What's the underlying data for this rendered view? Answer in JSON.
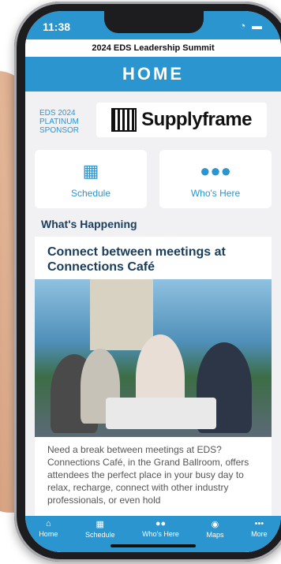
{
  "status": {
    "time": "11:38",
    "signal": "wifi battery"
  },
  "event": {
    "title": "2024 EDS Leadership Summit"
  },
  "header": {
    "title": "HOME"
  },
  "sponsor": {
    "label": "EDS 2024 PLATINUM SPONSOR",
    "logo_text": "Supplyframe"
  },
  "tiles": [
    {
      "label": "Schedule",
      "icon": "calendar-icon"
    },
    {
      "label": "Who's Here",
      "icon": "people-icon"
    }
  ],
  "section": {
    "title": "What's Happening"
  },
  "card": {
    "title": "Connect between meetings at Connections Café",
    "body": "Need a break between meetings at EDS? Connections Café, in the Grand Ballroom, offers attendees the perfect place in your busy day to relax, recharge, connect with other industry professionals, or even hold"
  },
  "tabbar": [
    {
      "label": "Home",
      "icon": "home-icon"
    },
    {
      "label": "Schedule",
      "icon": "calendar-icon"
    },
    {
      "label": "Who's Here",
      "icon": "people-icon"
    },
    {
      "label": "Maps",
      "icon": "map-pin-icon"
    },
    {
      "label": "More",
      "icon": "ellipsis-icon"
    }
  ],
  "colors": {
    "accent": "#2b95cf",
    "title": "#1b3d5c"
  }
}
